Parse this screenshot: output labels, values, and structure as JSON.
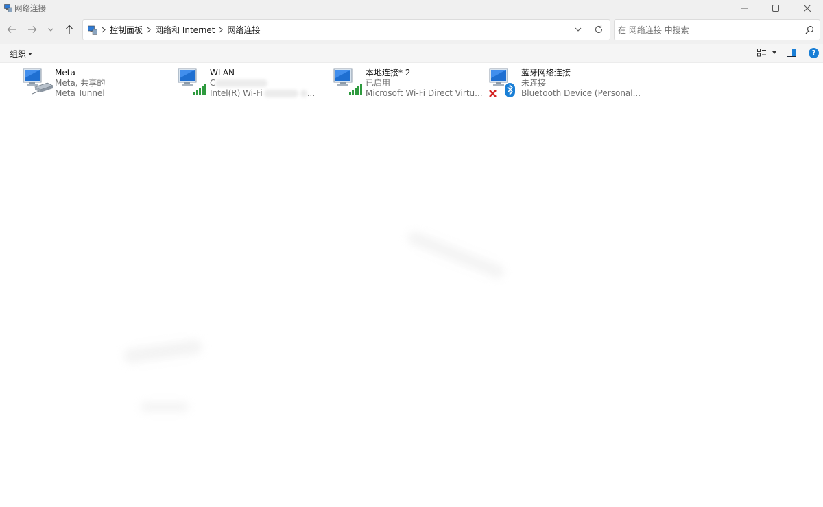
{
  "window": {
    "title": "网络连接"
  },
  "nav": {
    "back": "back",
    "forward": "forward",
    "recent": "recent",
    "up": "up"
  },
  "address": {
    "crumbs": [
      "控制面板",
      "网络和 Internet",
      "网络连接"
    ]
  },
  "search": {
    "placeholder": "在 网络连接 中搜索"
  },
  "toolbar": {
    "organize_label": "组织"
  },
  "connections": [
    {
      "name": "Meta",
      "status": "Meta, 共享的",
      "device": "Meta Tunnel",
      "badge": "cable"
    },
    {
      "name": "WLAN",
      "status": "C",
      "device": "Intel(R) Wi-Fi",
      "device_suffix": "...",
      "badge": "signal"
    },
    {
      "name": "本地连接* 2",
      "status": "已启用",
      "device": "Microsoft Wi-Fi Direct Virtu...",
      "badge": "signal"
    },
    {
      "name": "蓝牙网络连接",
      "status": "未连接",
      "device": "Bluetooth Device (Personal...",
      "badge": "bluetooth-disconnected"
    }
  ],
  "colors": {
    "accent": "#1a7fd6",
    "signal": "#2e9a3e",
    "error": "#d42424",
    "monitor": "#1f6fd1"
  },
  "icons": [
    "network-icon",
    "chevron-right-icon",
    "chevron-down-icon",
    "refresh-icon",
    "search-icon",
    "view-options-icon",
    "preview-pane-icon",
    "help-icon",
    "signal-bars-icon",
    "bluetooth-icon",
    "x-mark-icon"
  ]
}
